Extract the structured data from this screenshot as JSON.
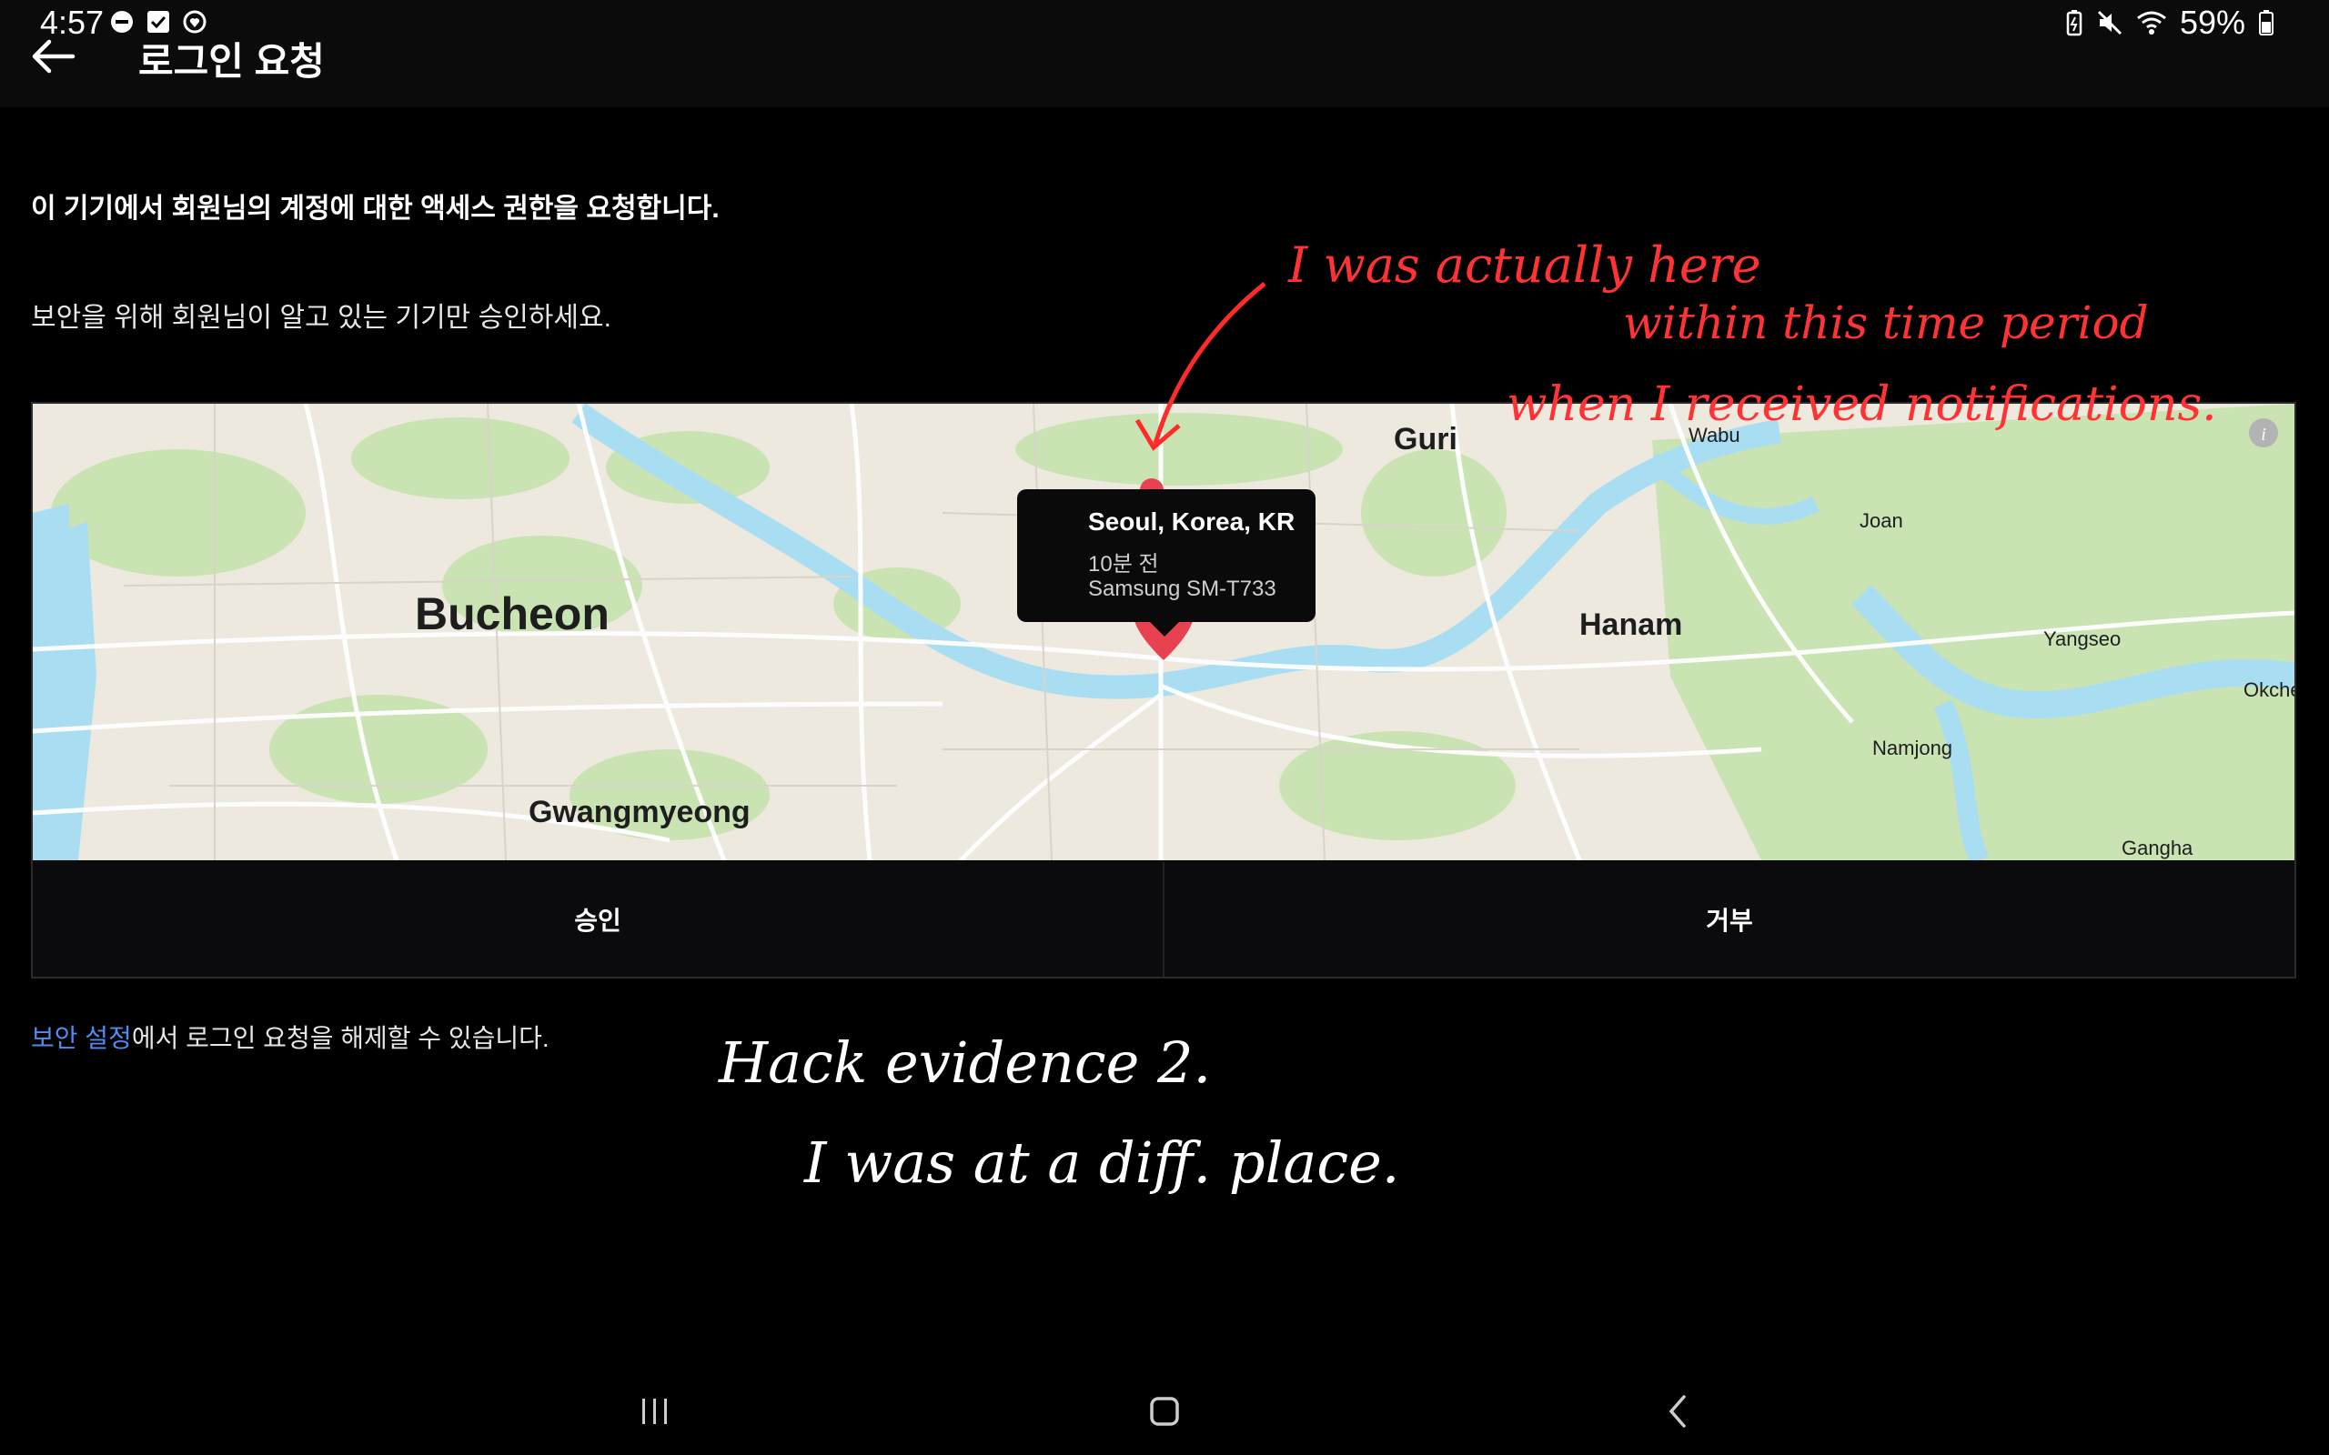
{
  "status_bar": {
    "time": "4:57",
    "battery": "59%",
    "left_icons": [
      "do-not-disturb-icon",
      "checkbox-icon",
      "shield-heart-icon"
    ],
    "right_icons": [
      "battery-saver-icon",
      "mute-icon",
      "wifi-icon",
      "battery-icon"
    ]
  },
  "app_bar": {
    "title": "로그인 요청"
  },
  "content": {
    "heading": "이 기기에서 회원님의 계정에 대한 액세스 권한을 요청합니다.",
    "subtext": "보안을 위해 회원님이 알고 있는 기기만 승인하세요."
  },
  "map": {
    "popup": {
      "location": "Seoul, Korea, KR",
      "time": "10분 전",
      "device": "Samsung SM-T733"
    },
    "labels": {
      "bucheon": "Bucheon",
      "gwangmyeong": "Gwangmyeong",
      "guri": "Guri",
      "hanam": "Hanam",
      "wabu": "Wabu",
      "joan": "Joan",
      "yangseo": "Yangseo",
      "namjong": "Namjong",
      "okche": "Okche",
      "gangha": "Gangha",
      "bucheon_top": "Bucheon"
    },
    "colors": {
      "land": "#ede9df",
      "park": "#c9e3b3",
      "water": "#a9def2",
      "road": "#ffffff",
      "pin": "#e8414f"
    }
  },
  "buttons": {
    "approve": "승인",
    "deny": "거부"
  },
  "footer": {
    "link": "보안 설정",
    "text": "에서 로그인 요청을 해제할 수 있습니다."
  },
  "annotations": {
    "red_line1": "I was actually here",
    "red_line2": "within this time period",
    "red_line3": "when I received notifications.",
    "white_line1": "Hack evidence 2.",
    "white_line2": "I was at a diff. place."
  }
}
